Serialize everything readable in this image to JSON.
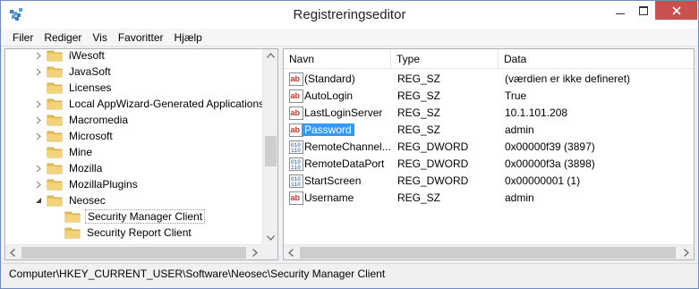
{
  "window": {
    "title": "Registreringseditor"
  },
  "menu": [
    "Filer",
    "Rediger",
    "Vis",
    "Favoritter",
    "Hjælp"
  ],
  "tree": {
    "items": [
      {
        "label": "iWesoft",
        "expandable": true
      },
      {
        "label": "JavaSoft",
        "expandable": true
      },
      {
        "label": "Licenses",
        "expandable": false
      },
      {
        "label": "Local AppWizard-Generated Applications",
        "expandable": true
      },
      {
        "label": "Macromedia",
        "expandable": true
      },
      {
        "label": "Microsoft",
        "expandable": true
      },
      {
        "label": "Mine",
        "expandable": false
      },
      {
        "label": "Mozilla",
        "expandable": true
      },
      {
        "label": "MozillaPlugins",
        "expandable": true
      },
      {
        "label": "Neosec",
        "expandable": true,
        "expanded": true
      },
      {
        "label": "Security Manager Client",
        "child": true,
        "selected": true
      },
      {
        "label": "Security Report Client",
        "child": true
      }
    ]
  },
  "list": {
    "columns": [
      "Navn",
      "Type",
      "Data"
    ],
    "rows": [
      {
        "name": "(Standard)",
        "type": "REG_SZ",
        "data": "(værdien er ikke defineret)",
        "icon": "string-value-icon"
      },
      {
        "name": "AutoLogin",
        "type": "REG_SZ",
        "data": "True",
        "icon": "string-value-icon"
      },
      {
        "name": "LastLoginServer",
        "type": "REG_SZ",
        "data": "10.1.101.208",
        "icon": "string-value-icon"
      },
      {
        "name": "Password",
        "type": "REG_SZ",
        "data": "admin",
        "icon": "string-value-icon",
        "selected": true
      },
      {
        "name": "RemoteChannel...",
        "type": "REG_DWORD",
        "data": "0x00000f39 (3897)",
        "icon": "binary-value-icon"
      },
      {
        "name": "RemoteDataPort",
        "type": "REG_DWORD",
        "data": "0x00000f3a (3898)",
        "icon": "binary-value-icon"
      },
      {
        "name": "StartScreen",
        "type": "REG_DWORD",
        "data": "0x00000001 (1)",
        "icon": "binary-value-icon"
      },
      {
        "name": "Username",
        "type": "REG_SZ",
        "data": "admin",
        "icon": "string-value-icon"
      }
    ]
  },
  "status": {
    "path": "Computer\\HKEY_CURRENT_USER\\Software\\Neosec\\Security Manager Client"
  },
  "colors": {
    "selection": "#3399ff",
    "close_button": "#c7514e",
    "folder": "#e8c158"
  }
}
